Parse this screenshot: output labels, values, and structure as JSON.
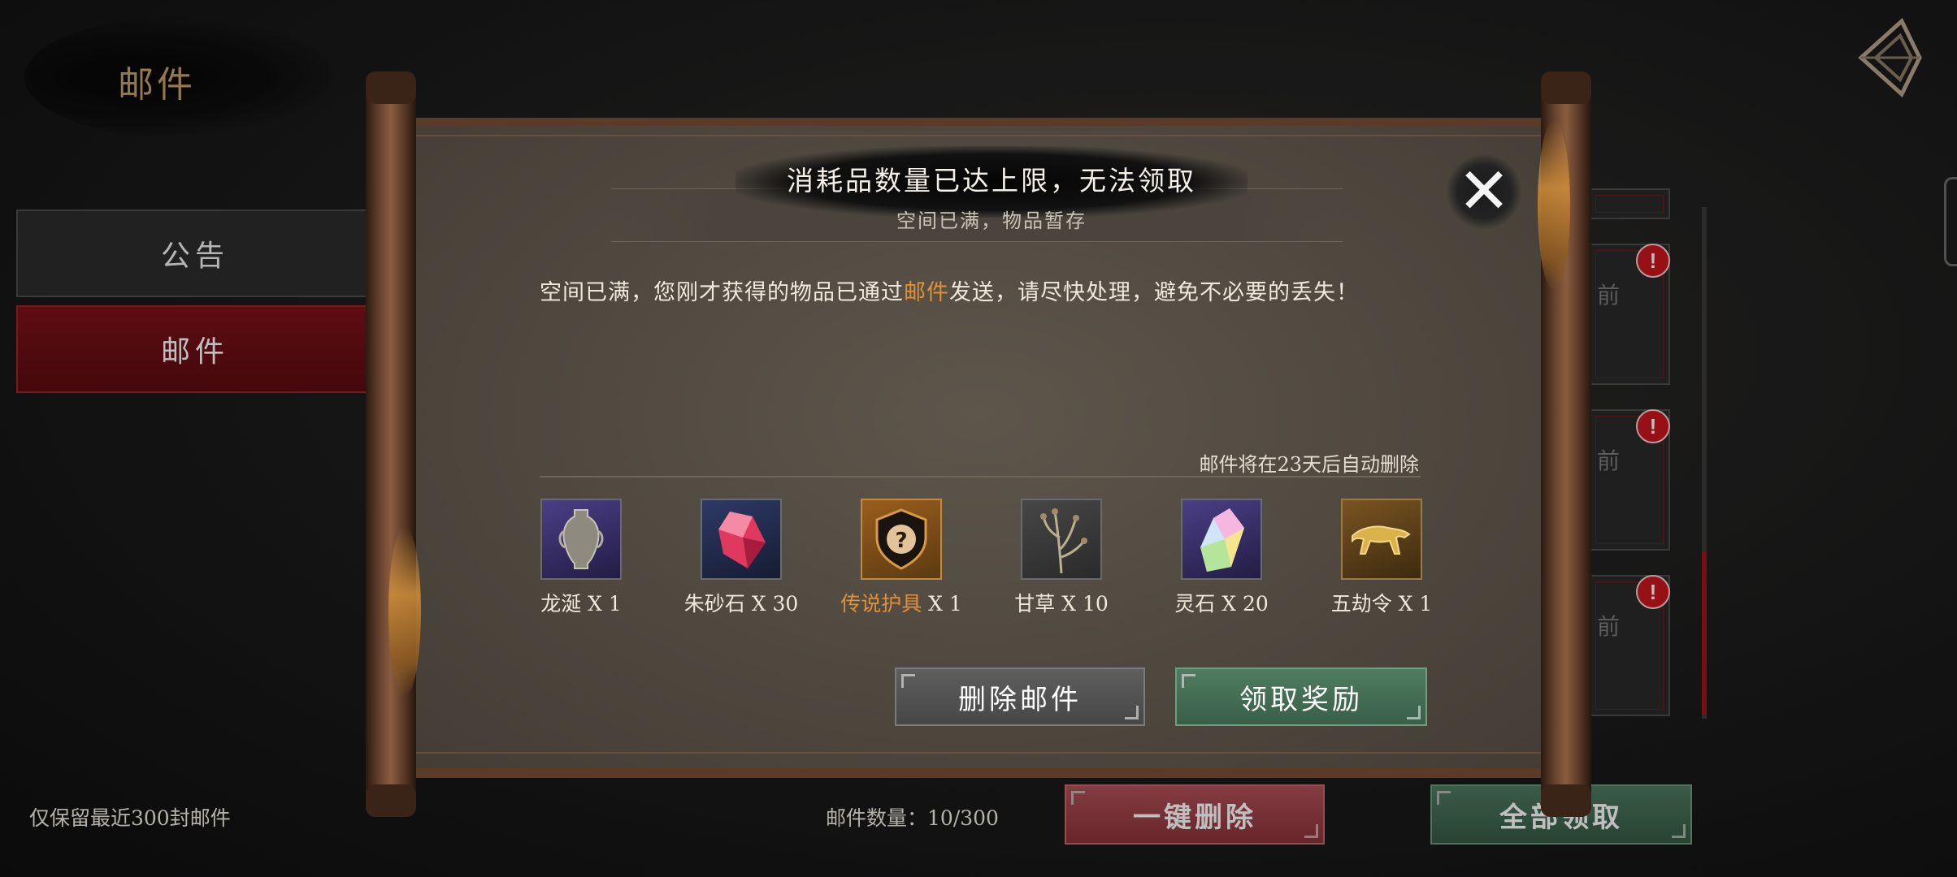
{
  "header": {
    "title": "邮件",
    "back_icon": "back-diamond-icon"
  },
  "sidebar": {
    "tabs": [
      {
        "label": "公告",
        "selected": false
      },
      {
        "label": "邮件",
        "selected": true
      }
    ]
  },
  "footer": {
    "keep_note": "仅保留最近300封邮件",
    "mail_count_label": "邮件数量：",
    "mail_count_value": "10/300",
    "delete_all_label": "一键删除",
    "claim_all_label": "全部领取"
  },
  "mail_list": {
    "cards": [
      {
        "glyph": "前"
      },
      {
        "glyph": "前"
      },
      {
        "glyph": "前"
      }
    ],
    "alert_glyph": "!"
  },
  "dialog": {
    "title": "消耗品数量已达上限，无法领取",
    "subtitle": "空间已满，物品暂存",
    "message_before": "空间已满，您刚才获得的物品已通过",
    "message_highlight": "邮件",
    "message_after": "发送，请尽快处理，避免不必要的丢失！",
    "expire_note": "邮件将在23天后自动删除",
    "items": [
      {
        "name": "龙涎",
        "qty": "X 1",
        "legendary": false,
        "icon": "vase-icon",
        "frame": "#3a2f6a"
      },
      {
        "name": "朱砂石",
        "qty": "X 30",
        "legendary": false,
        "icon": "red-crystal-icon",
        "frame": "#29335a"
      },
      {
        "name": "传说护具",
        "qty": "X 1",
        "legendary": true,
        "icon": "mystery-armor-icon",
        "frame": "#7a4a18"
      },
      {
        "name": "甘草",
        "qty": "X 10",
        "legendary": false,
        "icon": "herb-icon",
        "frame": "#3a3a3a"
      },
      {
        "name": "灵石",
        "qty": "X 20",
        "legendary": false,
        "icon": "spirit-crystal-icon",
        "frame": "#3a2f6a"
      },
      {
        "name": "五劫令",
        "qty": "X 1",
        "legendary": false,
        "icon": "golden-tiger-icon",
        "frame": "#6a4a1e"
      }
    ],
    "delete_label": "删除邮件",
    "claim_label": "领取奖励",
    "close_glyph": "✕"
  },
  "colors": {
    "highlight": "#e0913a",
    "selected_tab": "#7d1219",
    "claim_green": "#4e7b60",
    "delete_red": "#b05158"
  }
}
